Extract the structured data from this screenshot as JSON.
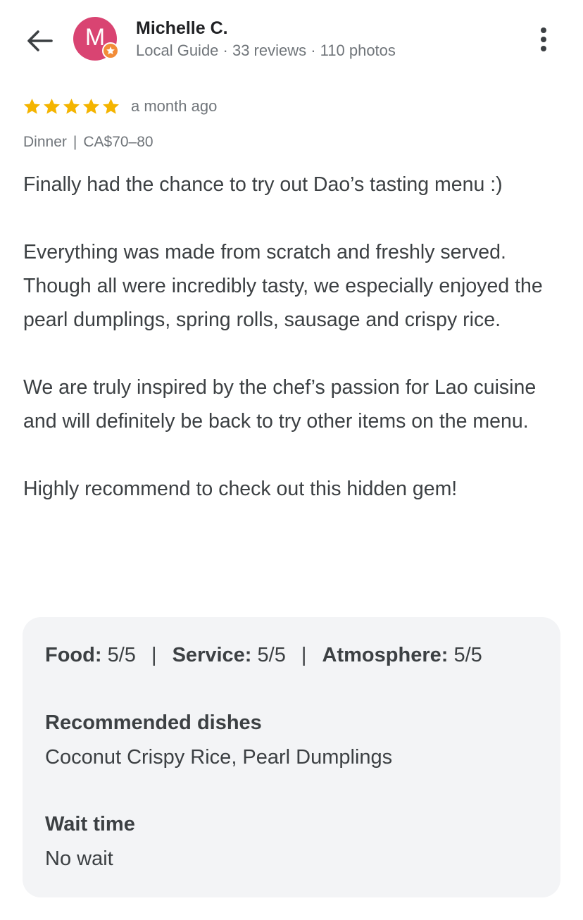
{
  "header": {
    "back_icon": "arrow-back-icon",
    "avatar_letter": "M",
    "avatar_color": "#d94472",
    "badge_icon": "local-guide-star-icon",
    "badge_color": "#f28c38",
    "user_name": "Michelle C.",
    "user_meta": "Local Guide · 33 reviews · 110 photos",
    "menu_icon": "more-vert-icon"
  },
  "review": {
    "rating": 5,
    "max_rating": 5,
    "star_color": "#f4b400",
    "date": "a month ago",
    "meal_type": "Dinner",
    "meal_separator": "|",
    "price_range": "CA$70–80",
    "paragraphs": [
      "Finally had the chance to try out Dao’s tasting menu :)",
      "Everything was made from scratch and freshly served. Though all were incredibly tasty, we especially enjoyed the pearl dumplings, spring rolls, sausage and crispy rice.",
      "We are truly inspired by the chef’s passion for Lao cuisine and will definitely be back to try other items on the menu.",
      "Highly recommend to check out this hidden gem!"
    ]
  },
  "details": {
    "aspects": [
      {
        "label": "Food",
        "value": "5/5"
      },
      {
        "label": "Service",
        "value": "5/5"
      },
      {
        "label": "Atmosphere",
        "value": "5/5"
      }
    ],
    "aspect_separator": "|",
    "recommended_heading": "Recommended dishes",
    "recommended_value": "Coconut Crispy Rice, Pearl Dumplings",
    "wait_heading": "Wait time",
    "wait_value": "No wait"
  }
}
